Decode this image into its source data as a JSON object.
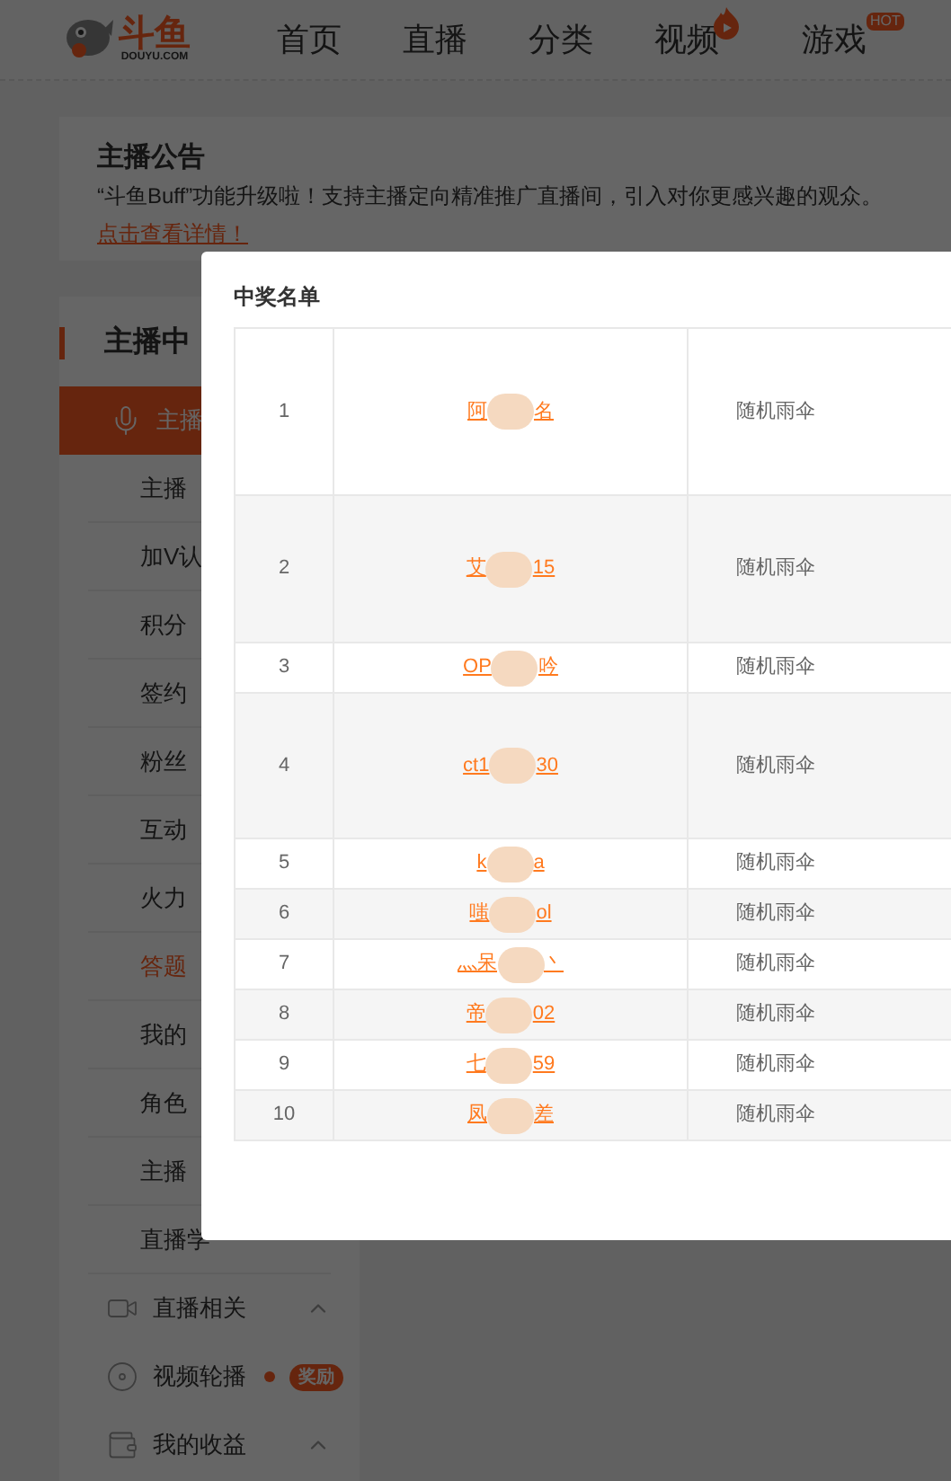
{
  "header": {
    "logo": {
      "text": "斗鱼",
      "domain": "DOUYU.COM"
    },
    "nav": [
      {
        "label": "首页",
        "kind": "plain"
      },
      {
        "label": "直播",
        "kind": "plain"
      },
      {
        "label": "分类",
        "kind": "plain"
      },
      {
        "label": "视频",
        "kind": "flame"
      },
      {
        "label": "游戏",
        "kind": "hot",
        "badge": "HOT"
      }
    ]
  },
  "announcement": {
    "title": "主播公告",
    "text": "“斗鱼Buff”功能升级啦！支持主播定向精准推广直播间，引入对你更感兴趣的观众。",
    "link": "点击查看详情！"
  },
  "sidebar": {
    "title": "主播中",
    "group": {
      "label": "主播",
      "selected": true,
      "children": [
        {
          "label": "主播",
          "highlighted": false
        },
        {
          "label": "加V认",
          "highlighted": false
        },
        {
          "label": "积分",
          "highlighted": false
        },
        {
          "label": "签约",
          "highlighted": false
        },
        {
          "label": "粉丝",
          "highlighted": false
        },
        {
          "label": "互动",
          "highlighted": false
        },
        {
          "label": "火力",
          "highlighted": false
        },
        {
          "label": "答题",
          "highlighted": true
        },
        {
          "label": "我的",
          "highlighted": false
        },
        {
          "label": "角色",
          "highlighted": false
        },
        {
          "label": "主播",
          "highlighted": false
        },
        {
          "label": "直播学",
          "highlighted": false
        }
      ]
    },
    "sections": [
      {
        "label": "直播相关",
        "kind": "video"
      },
      {
        "label": "视频轮播",
        "kind": "carousel",
        "badge": "奖励"
      },
      {
        "label": "我的收益",
        "kind": "income"
      }
    ]
  },
  "dialog": {
    "title": "中奖名单",
    "rows": [
      {
        "rank": "1",
        "name_start": "阿",
        "name_end": "名",
        "prize": "随机雨伞"
      },
      {
        "rank": "2",
        "name_start": "艾",
        "name_end": "15",
        "prize": "随机雨伞"
      },
      {
        "rank": "3",
        "name_start": "OP",
        "name_end": "吟",
        "prize": "随机雨伞"
      },
      {
        "rank": "4",
        "name_start": "ct1",
        "name_end": "30",
        "prize": "随机雨伞"
      },
      {
        "rank": "5",
        "name_start": "k",
        "name_end": "a",
        "prize": "随机雨伞"
      },
      {
        "rank": "6",
        "name_start": "嗤",
        "name_end": "ol",
        "prize": "随机雨伞"
      },
      {
        "rank": "7",
        "name_start": "灬呆",
        "name_end": "丶",
        "prize": "随机雨伞"
      },
      {
        "rank": "8",
        "name_start": "帝",
        "name_end": "02",
        "prize": "随机雨伞"
      },
      {
        "rank": "9",
        "name_start": "七",
        "name_end": "59",
        "prize": "随机雨伞"
      },
      {
        "rank": "10",
        "name_start": "凤",
        "name_end": "差",
        "prize": "随机雨伞"
      }
    ]
  }
}
